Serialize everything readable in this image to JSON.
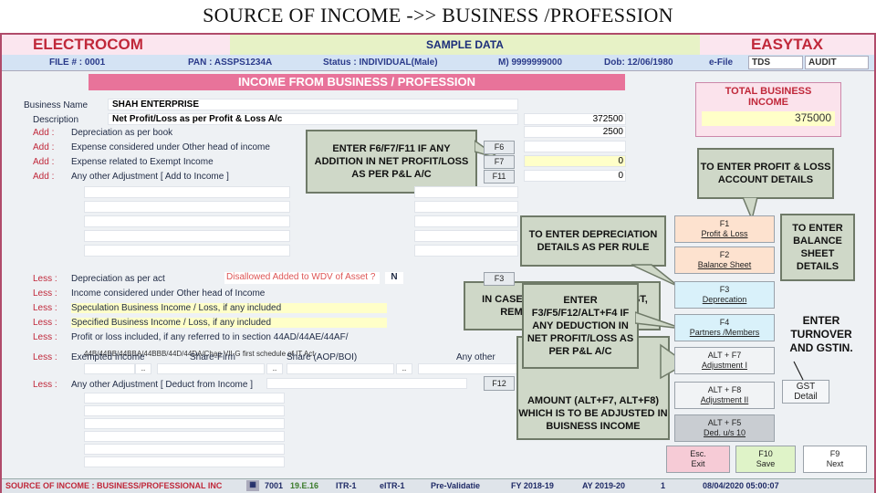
{
  "slide_title": "SOURCE OF INCOME ->> BUSINESS /PROFESSION",
  "header": {
    "brand_left": "ELECTROCOM",
    "center": "SAMPLE DATA",
    "brand_right": "EASYTAX"
  },
  "infobar": {
    "file": "FILE # : 0001",
    "pan": "PAN : ASSPS1234A",
    "status": "Status : INDIVIDUAL(Male)",
    "mobile": "M) 9999999000",
    "dob": "Dob: 12/06/1980",
    "efile": "e-File",
    "tds": "TDS",
    "audit": "AUDIT"
  },
  "section_title": "INCOME FROM BUSINESS / PROFESSION",
  "total": {
    "label": "TOTAL BUSINESS INCOME",
    "value": "375000"
  },
  "business": {
    "name_label": "Business Name",
    "name_value": "SHAH ENTERPRISE",
    "desc_label": "Description",
    "desc_value": "Net Profit/Loss as per Profit & Loss A/c",
    "net_value": "372500"
  },
  "add_rows": [
    {
      "prefix": "Add :",
      "text": "Depreciation as per book",
      "key": "",
      "value": "2500"
    },
    {
      "prefix": "Add :",
      "text": "Expense considered under Other head of income",
      "key": "F6",
      "value": ""
    },
    {
      "prefix": "Add :",
      "text": "Expense related to Exempt Income",
      "key": "F7",
      "value": "0"
    },
    {
      "prefix": "Add :",
      "text": "Any other Adjustment   [ Add to Income ]",
      "key": "F11",
      "value": "0"
    }
  ],
  "less_rows": [
    {
      "prefix": "Less  :",
      "text": "Depreciation as per act",
      "extra": "Disallowed Added to WDV of Asset ?",
      "flag": "N",
      "key": "F3"
    },
    {
      "prefix": "Less  :",
      "text": "Income considered under Other head of Income",
      "extra": "",
      "flag": "",
      "key": ""
    },
    {
      "prefix": "Less  :",
      "text": "Speculation Business Income / Loss, if any included",
      "extra": "",
      "flag": "",
      "key": ""
    },
    {
      "prefix": "Less  :",
      "text": "Specified Business Income / Loss, if any included",
      "extra": "",
      "flag": "",
      "key": ""
    },
    {
      "prefix": "Less  :",
      "text": "Profit or loss included, if any referred to in section 44AD/44AE/44AF/",
      "extra": "",
      "flag": "",
      "key": ""
    }
  ],
  "section_note": "44B/44BB/44BBA/44BBB/44D/44DA/Chap VII-G first schedule of IT Act",
  "exempt": {
    "prefix": "Less  :",
    "label": "Exempted Income",
    "share_firm": "Share-Firm",
    "share_aop": "Share (AOP/BOI)",
    "any_other": "Any other",
    "ellipsis": ".."
  },
  "other_adj": {
    "prefix": "Less  :",
    "text": "Any other Adjustment   [ Deduct from Income ]",
    "key": "F12"
  },
  "callouts": {
    "f6": "ENTER F6/F7/F11 IF ANY ADDITION IN NET PROFIT/LOSS AS PER P&L A/C",
    "pl": "TO ENTER PROFIT & LOSS ACCOUNT DETAILS",
    "dep": "TO ENTER DEPRECIATION DETAILS AS PER RULE",
    "bal": "TO ENTER BALANCE SHEET DETAILS",
    "partner_hidden": "IN CASE OF FIRM, ADD INTEREST, REMUNERATION & OTHER",
    "deduct": "ENTER F3/F5/F12/ALT+F4 IF ANY DEDUCTION IN NET PROFIT/LOSS AS PER P&L A/C",
    "adj": "AMOUNT (ALT+F7, ALT+F8) WHICH IS TO BE ADJUSTED IN BUISNESS INCOME",
    "gst": "ENTER TURNOVER AND GSTIN."
  },
  "fkeys": [
    {
      "key": "F1",
      "label": "Profit & Loss"
    },
    {
      "key": "F2",
      "label": "Balance Sheet"
    },
    {
      "key": "F3",
      "label": "Deprecation"
    },
    {
      "key": "F4",
      "label": "Partners /Members"
    },
    {
      "key": "ALT + F7",
      "label": "Adjustment I"
    },
    {
      "key": "ALT + F8",
      "label": "Adjustment II"
    },
    {
      "key": "ALT + F5",
      "label": "Ded. u/s 10"
    }
  ],
  "gst_btn": {
    "key": "GST",
    "label": "Detail"
  },
  "bottom_btns": [
    {
      "key": "Esc.",
      "label": "Exit"
    },
    {
      "key": "F10",
      "label": "Save"
    },
    {
      "key": "F9",
      "label": "Next"
    }
  ],
  "statusbar": {
    "title": "SOURCE OF INCOME : BUSINESS/PROFESSIONAL INC",
    "code": "7001",
    "ver": "19.E.16",
    "itr": "ITR-1",
    "eitr": "eITR-1",
    "prev": "Pre-Validatie",
    "fy": "FY 2018-19",
    "ay": "AY 2019-20",
    "one": "1",
    "dt": "08/04/2020 05:00:07"
  }
}
